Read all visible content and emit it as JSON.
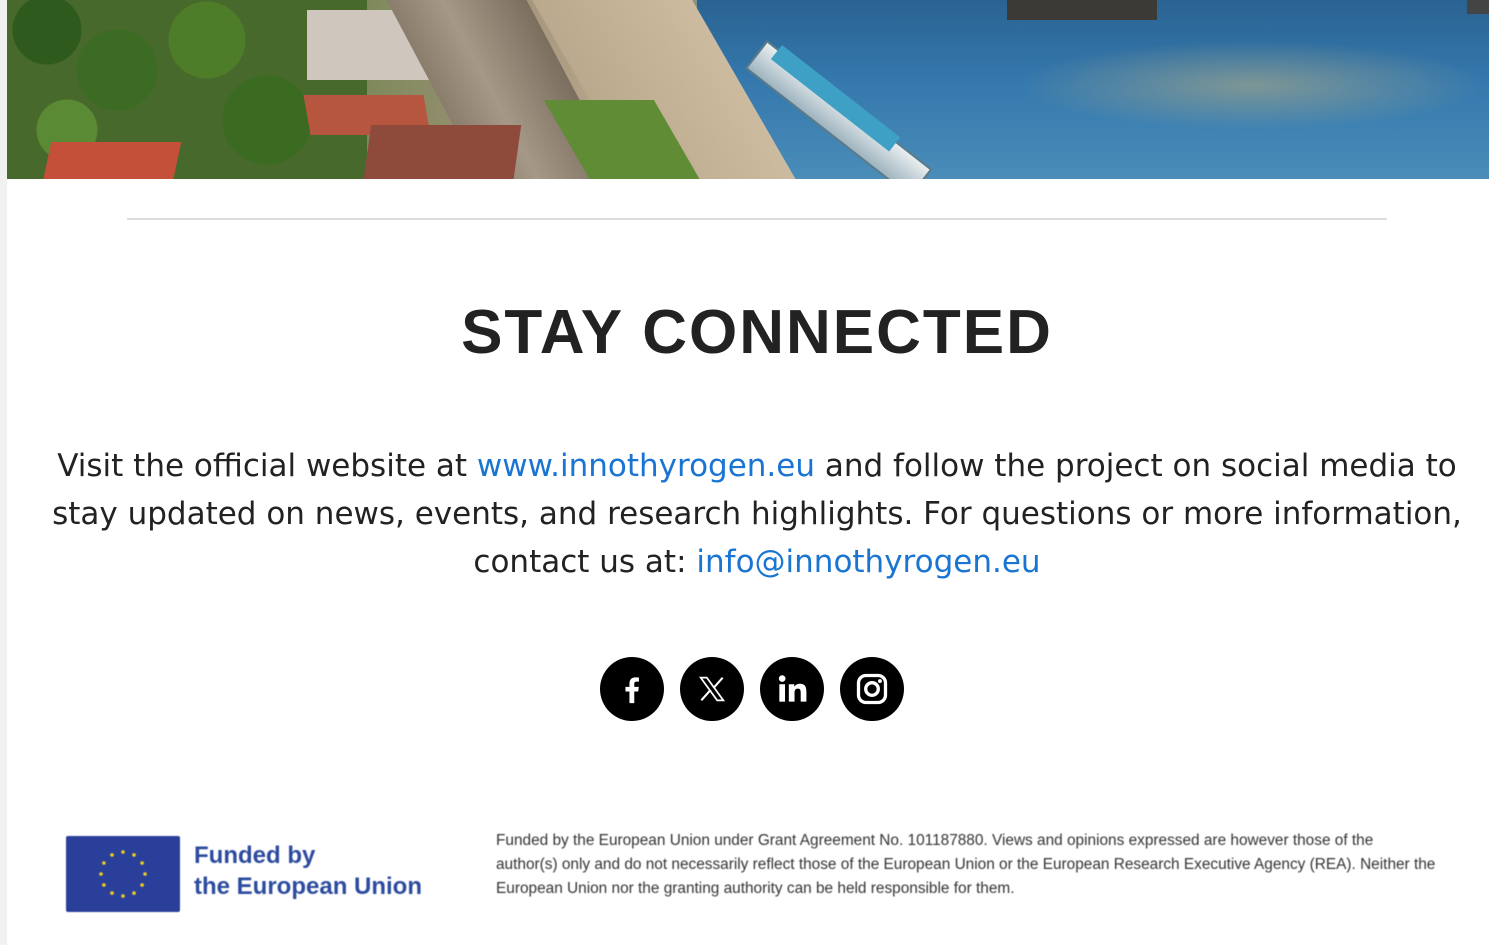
{
  "hero": {
    "image_alt": "Aerial photo of a riverside city with a promenade and river cruise ships"
  },
  "section": {
    "heading": "STAY CONNECTED",
    "paragraph_before_link": "Visit the official website at ",
    "website_link": "www.innothyrogen.eu",
    "paragraph_middle": " and follow the project on social media to stay updated on news, events, and research highlights. For questions or more information, contact us at: ",
    "email_link": "info@innothyrogen.eu",
    "link_color": "#1a75d2"
  },
  "social": [
    {
      "name": "facebook",
      "icon": "facebook-icon"
    },
    {
      "name": "x",
      "icon": "x-icon"
    },
    {
      "name": "linkedin",
      "icon": "linkedin-icon"
    },
    {
      "name": "instagram",
      "icon": "instagram-icon"
    }
  ],
  "footer": {
    "eu_line1": "Funded by",
    "eu_line2": "the European Union",
    "eu_text_color": "#2c4b9e",
    "eu_flag_color": "#2a3f9a",
    "disclaimer": "Funded by the European Union under Grant Agreement No. 101187880. Views and opinions expressed are however those of the author(s) only and do not necessarily reflect those of the European Union or the European Research Executive Agency (REA). Neither the European Union nor the granting authority can be held responsible for them."
  }
}
